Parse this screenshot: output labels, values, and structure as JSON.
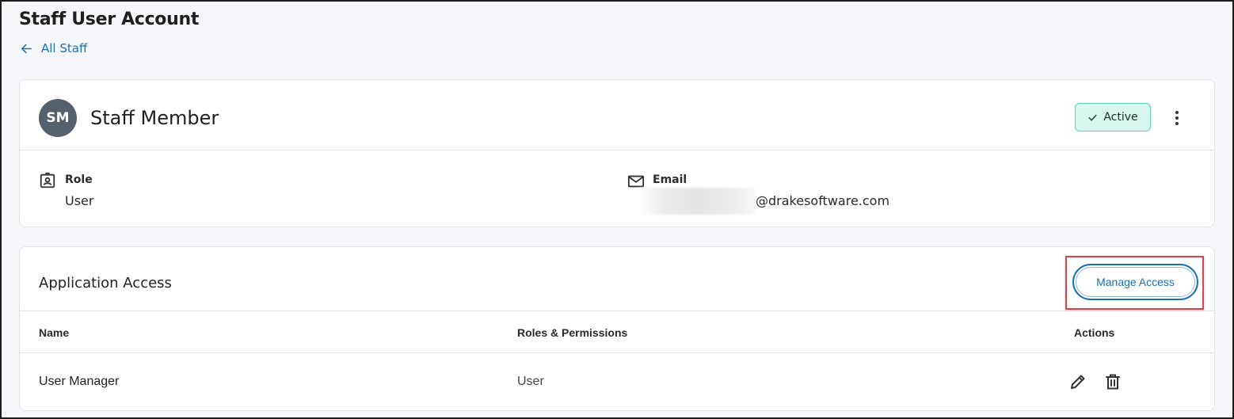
{
  "page": {
    "title": "Staff User Account",
    "back_link": "All Staff"
  },
  "profile": {
    "initials": "SM",
    "name": "Staff Member",
    "status": "Active",
    "role_label": "Role",
    "role_value": "User",
    "email_label": "Email",
    "email_value": "@drakesoftware.com"
  },
  "access": {
    "title": "Application Access",
    "manage_button": "Manage Access",
    "columns": [
      "Name",
      "Roles & Permissions",
      "Actions"
    ],
    "rows": [
      {
        "name": "User Manager",
        "role": "User"
      }
    ]
  },
  "icons": {
    "back": "arrow-left-icon",
    "status": "check-icon",
    "more": "more-vertical-icon",
    "role": "id-badge-icon",
    "email": "mail-icon",
    "edit": "pencil-icon",
    "delete": "trash-icon"
  },
  "colors": {
    "accent": "#1d6fb8",
    "status_bg": "#d8f7ee",
    "status_border": "#5fd3b3",
    "avatar_bg": "#55606d",
    "highlight": "#e0424a"
  }
}
